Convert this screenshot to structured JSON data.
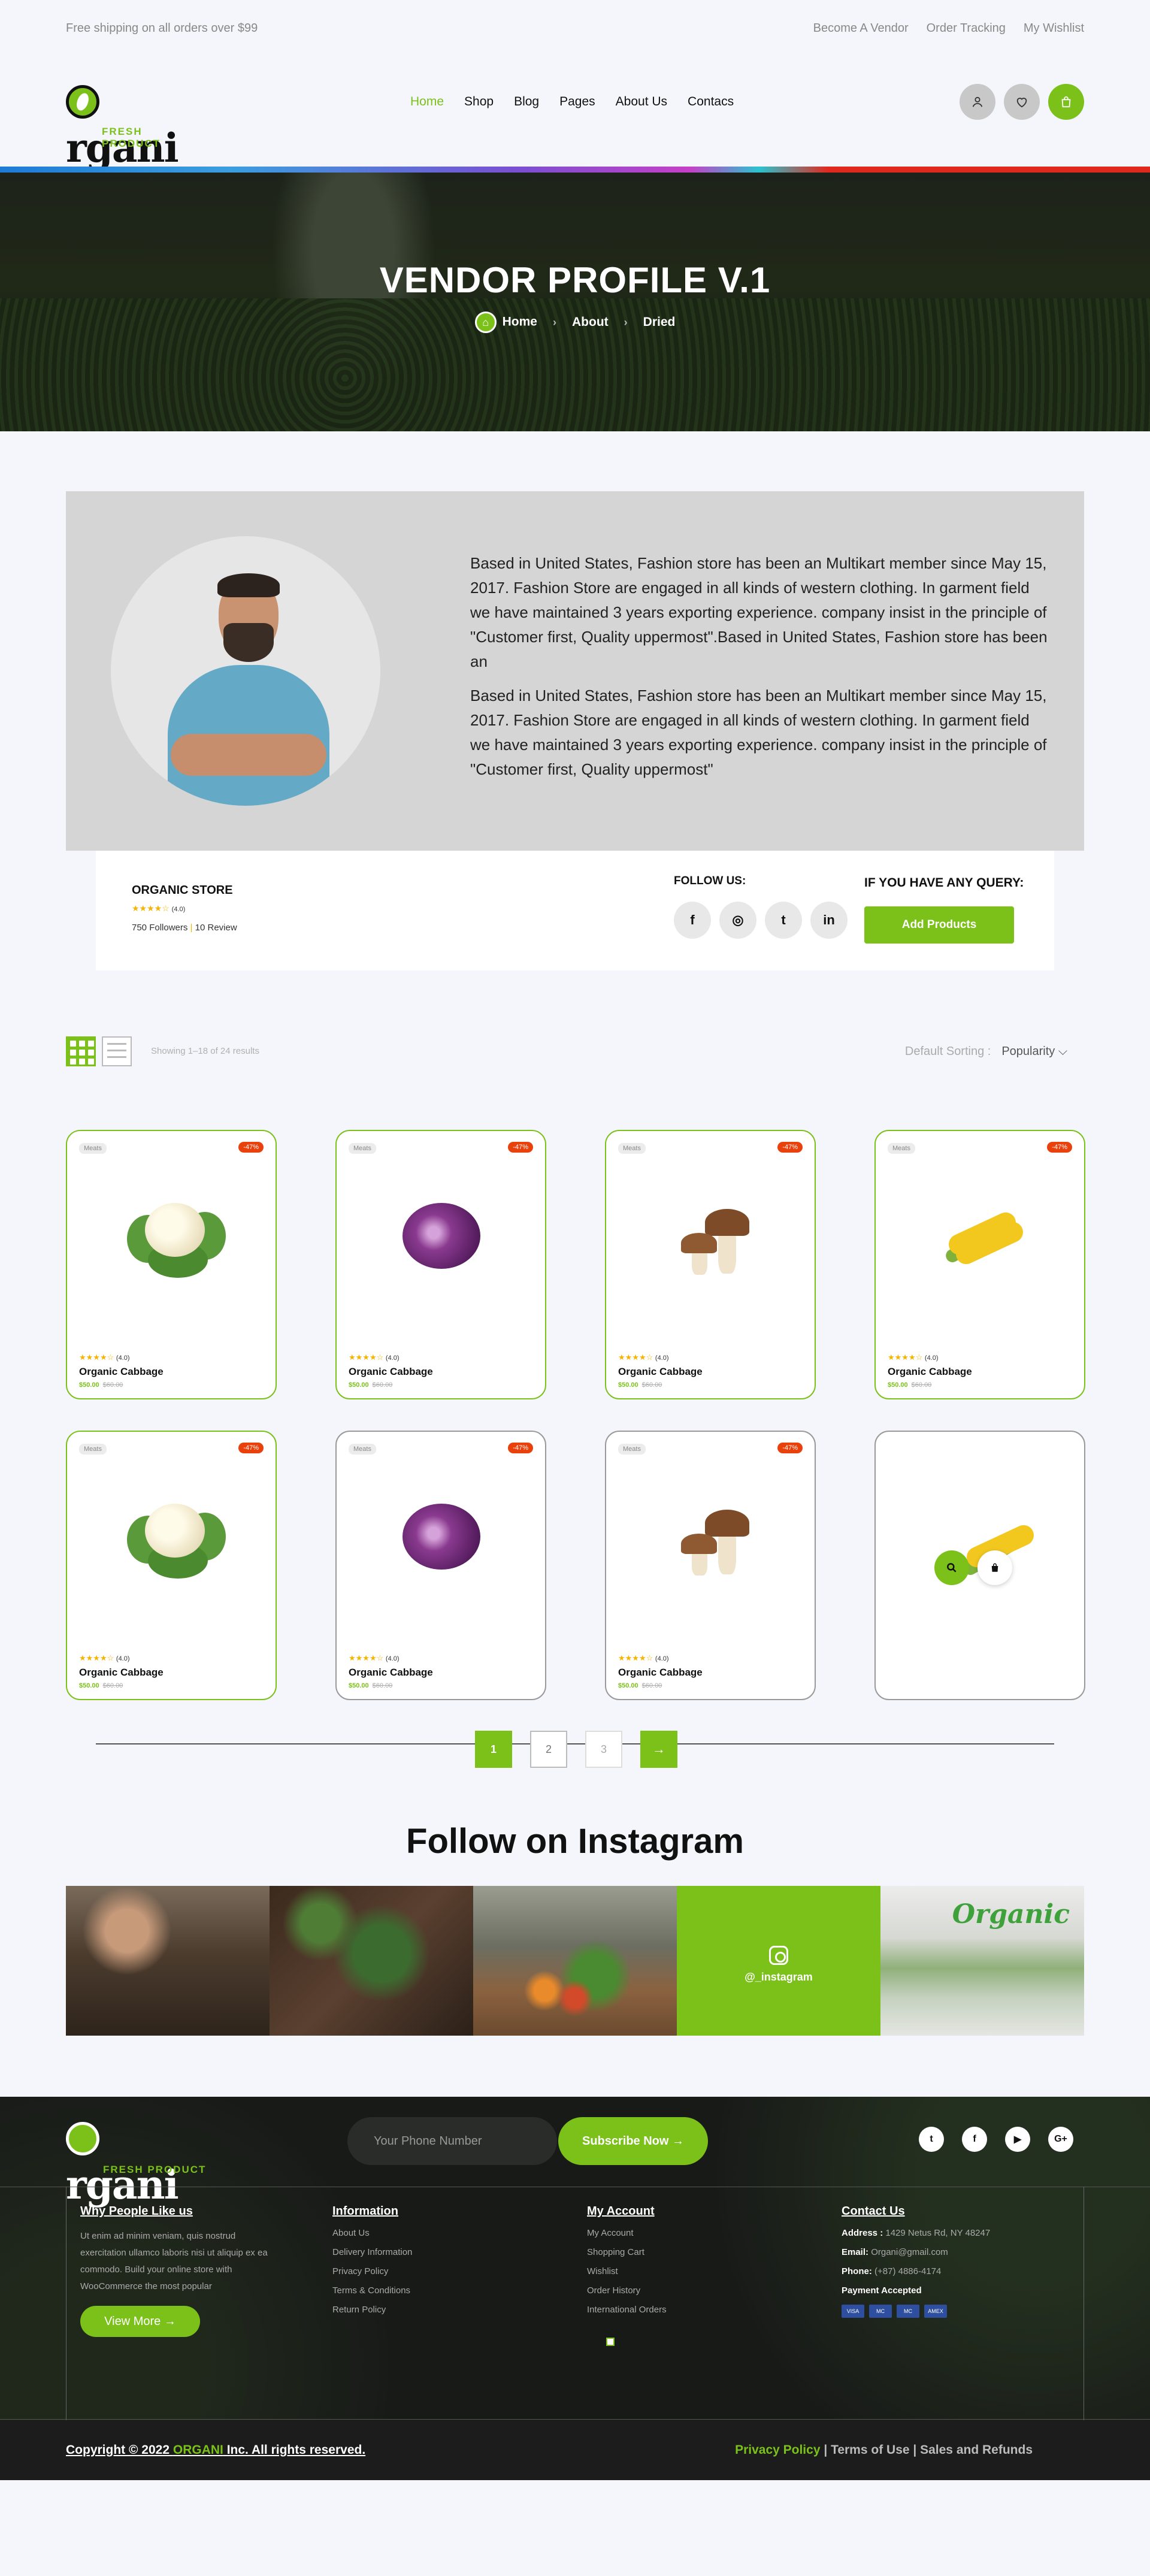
{
  "topbar": {
    "shipping": "Free shipping on all orders over $99",
    "links": [
      "Become A Vendor",
      "Order Tracking",
      "My Wishlist"
    ]
  },
  "brand": {
    "name": "rgani",
    "tagline": "FRESH PRODUCT",
    "accent": "#7bc11a"
  },
  "nav": {
    "items": [
      "Home",
      "Shop",
      "Blog",
      "Pages",
      "About Us",
      "Contacs"
    ],
    "active": "Home"
  },
  "header_icons": [
    "user-icon",
    "heart-icon",
    "bag-icon"
  ],
  "hero": {
    "title": "VENDOR PROFILE V.1",
    "breadcrumb": [
      "Home",
      "About",
      "Dried"
    ]
  },
  "vendor": {
    "para1": "Based in United States, Fashion store has been an Multikart member since May 15, 2017. Fashion Store are engaged in all kinds of western clothing. In garment field we have maintained 3 years exporting experience. company insist in the principle of \"Customer first, Quality uppermost\".Based in United States, Fashion store has been an",
    "para2": "Based in United States, Fashion store has been an Multikart member since May 15, 2017. Fashion Store are engaged in all kinds of western clothing. In garment field we have maintained 3 years exporting experience. company insist in the principle of \"Customer first, Quality uppermost\"",
    "store_name": "ORGANIC STORE",
    "stars": "★★★★☆",
    "rating": "(4.0)",
    "followers": "750 Followers",
    "reviews": "10 Review",
    "follow_label": "FOLLOW US:",
    "social": [
      "f",
      "◎",
      "t",
      "in"
    ],
    "query_label": "IF YOU HAVE ANY QUERY:",
    "add_button": "Add Products"
  },
  "toolbar": {
    "showing": "Showing 1–18 of 24 results",
    "sort_label": "Default Sorting :",
    "sort_value": "Popularity ⌵"
  },
  "products": [
    {
      "tag": "Meats",
      "off": "-47%",
      "stars": "★★★★☆",
      "rating": "(4.0)",
      "name": "Organic Cabbage",
      "price": "$50.00",
      "old": "$60.00",
      "img": "cauliflower"
    },
    {
      "tag": "Meats",
      "off": "-47%",
      "stars": "★★★★☆",
      "rating": "(4.0)",
      "name": "Organic Cabbage",
      "price": "$50.00",
      "old": "$60.00",
      "img": "cabbage"
    },
    {
      "tag": "Meats",
      "off": "-47%",
      "stars": "★★★★☆",
      "rating": "(4.0)",
      "name": "Organic Cabbage",
      "price": "$50.00",
      "old": "$60.00",
      "img": "mushroom"
    },
    {
      "tag": "Meats",
      "off": "-47%",
      "stars": "★★★★☆",
      "rating": "(4.0)",
      "name": "Organic Cabbage",
      "price": "$50.00",
      "old": "$60.00",
      "img": "corn"
    },
    {
      "tag": "Meats",
      "off": "-47%",
      "stars": "★★★★☆",
      "rating": "(4.0)",
      "name": "Organic Cabbage",
      "price": "$50.00",
      "old": "$60.00",
      "img": "cauliflower"
    },
    {
      "tag": "Meats",
      "off": "-47%",
      "stars": "★★★★☆",
      "rating": "(4.0)",
      "name": "Organic Cabbage",
      "price": "$50.00",
      "old": "$60.00",
      "img": "cabbage"
    },
    {
      "tag": "Meats",
      "off": "-47%",
      "stars": "★★★★☆",
      "rating": "(4.0)",
      "name": "Organic Cabbage",
      "price": "$50.00",
      "old": "$60.00",
      "img": "mushroom"
    }
  ],
  "pagination": {
    "pages": [
      "1",
      "2",
      "3"
    ],
    "current": "1",
    "next": "→"
  },
  "instagram": {
    "title": "Follow on Instagram",
    "handle": "@_instagram",
    "brand_text": "Organic"
  },
  "footer": {
    "phone_placeholder": "Your Phone Number",
    "subscribe": "Subscribe Now →",
    "social": [
      "t",
      "f",
      "▶",
      "G+"
    ],
    "why_title": "Why People Like us",
    "why_text": "Ut enim ad minim veniam, quis nostrud exercitation ullamco laboris nisi ut aliquip ex ea commodo. Build your online store with WooCommerce the most popular",
    "view_more": "View More →",
    "info_title": "Information",
    "info_links": [
      "About Us",
      "Delivery Information",
      "Privacy Policy",
      "Terms & Conditions",
      "Return Policy"
    ],
    "account_title": "My Account",
    "account_links": [
      "My Account",
      "Shopping Cart",
      "Wishlist",
      "Order History",
      "International Orders"
    ],
    "contact_title": "Contact Us",
    "address_label": "Address :",
    "address": "1429 Netus Rd, NY 48247",
    "email_label": "Email:",
    "email": "Organi@gmail.com",
    "phone_label": "Phone:",
    "phone": "(+87) 4886-4174",
    "payment_label": "Payment Accepted",
    "cards": [
      "VISA",
      "MC",
      "MC",
      "AMEX"
    ],
    "copyright_pre": "Copyright © 2022 ",
    "copyright_brand": "ORGANI",
    "copyright_post": " Inc. All rights reserved.",
    "legal": [
      "Privacy Policy",
      "Terms of Use",
      "Sales and Refunds"
    ]
  }
}
